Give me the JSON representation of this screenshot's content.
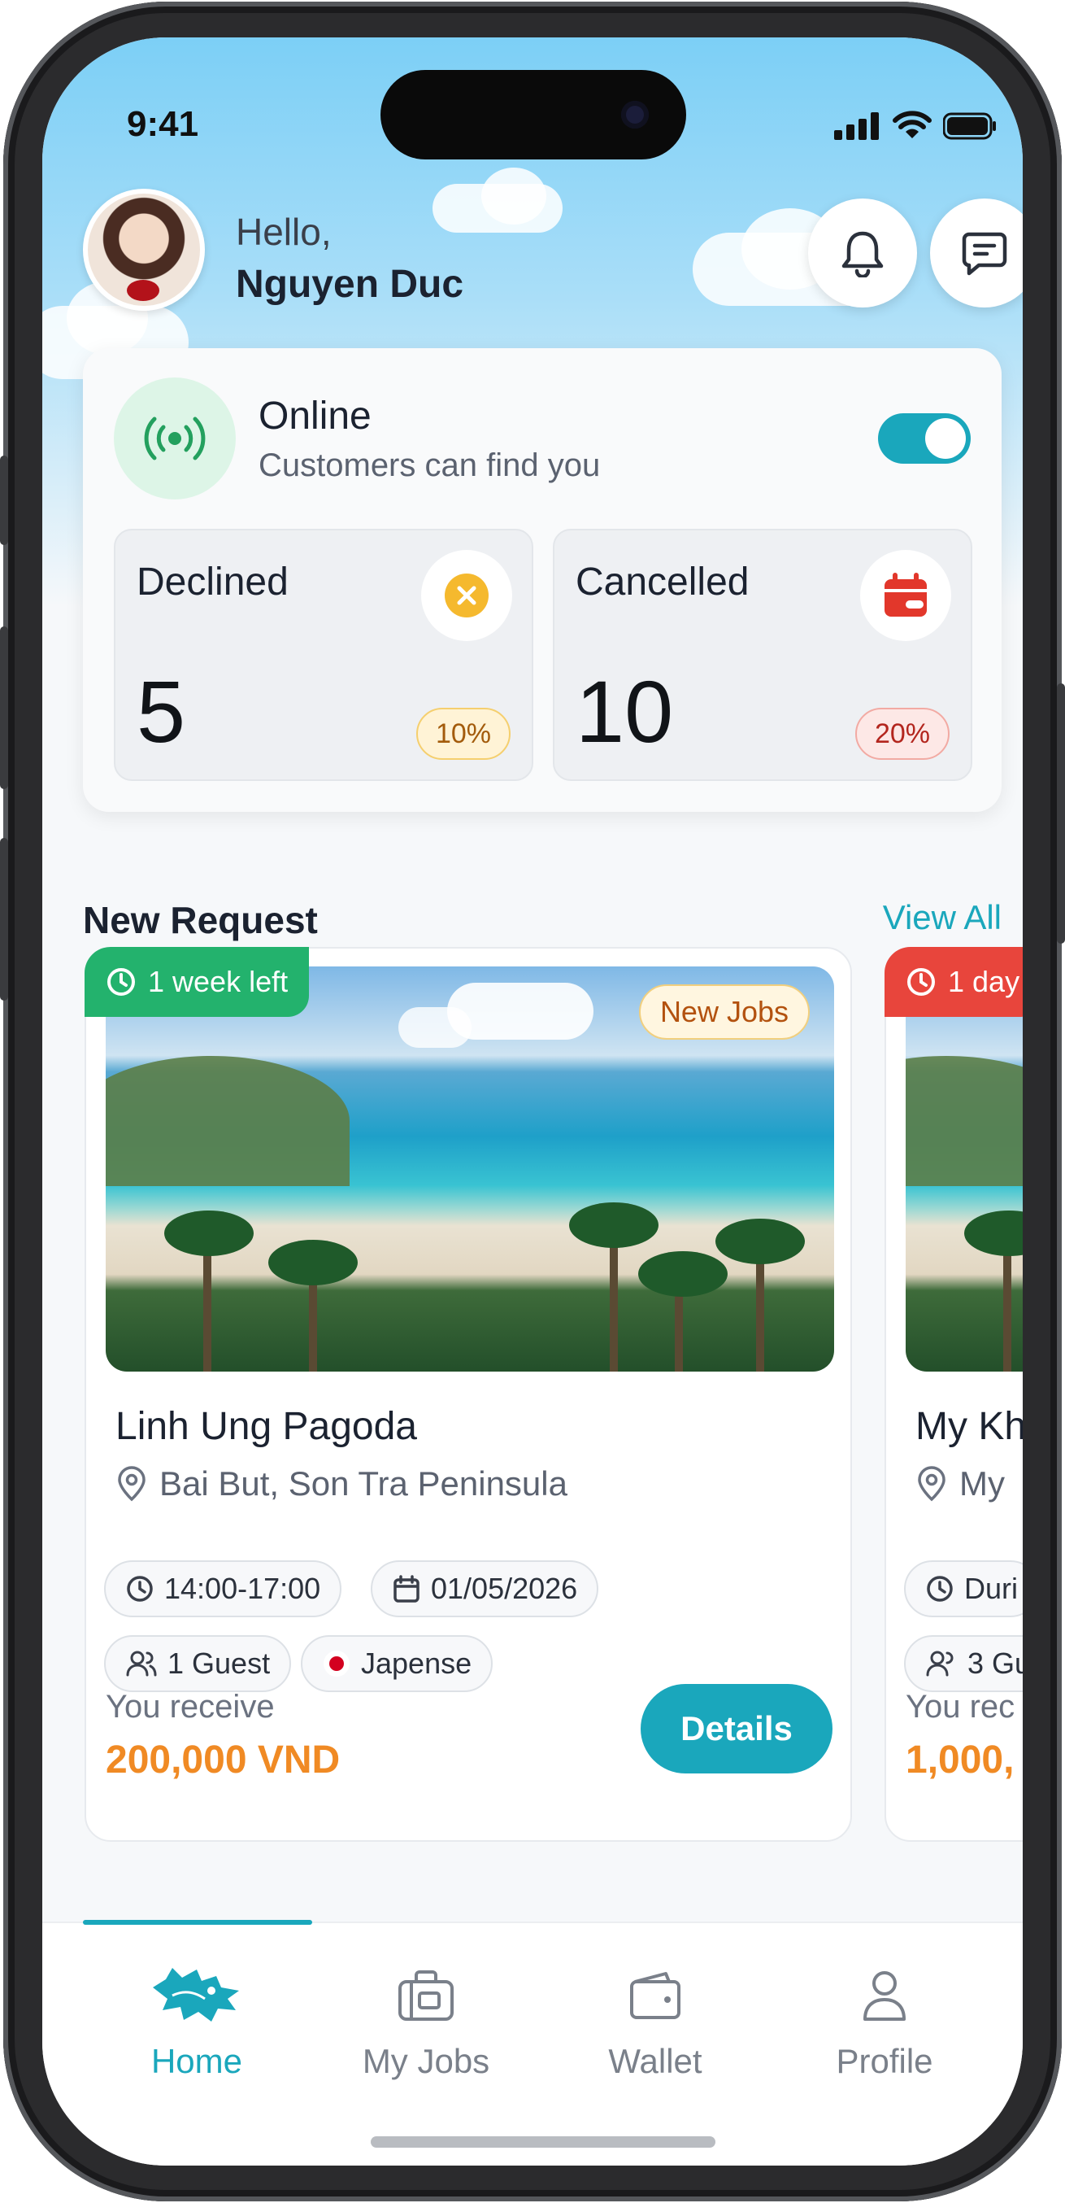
{
  "status_bar": {
    "time": "9:41"
  },
  "header": {
    "greeting": "Hello,",
    "user_name": "Nguyen Duc",
    "notification_icon": "bell-icon",
    "message_icon": "chat-icon"
  },
  "availability": {
    "title": "Online",
    "subtitle": "Customers can find you",
    "toggle_on": true,
    "icon": "broadcast-icon"
  },
  "stats": [
    {
      "label": "Declined",
      "value": "5",
      "percent": "10%",
      "icon": "x-circle-icon",
      "color": "#f5b92e"
    },
    {
      "label": "Cancelled",
      "value": "10",
      "percent": "20%",
      "icon": "calendar-cancel-icon",
      "color": "#e2372b"
    }
  ],
  "section": {
    "title": "New Request",
    "view_all": "View All"
  },
  "jobs": [
    {
      "deadline": "1 week left",
      "deadline_color": "#23b26d",
      "badge": "New Jobs",
      "title": "Linh Ung Pagoda",
      "location": "Bai But, Son Tra Peninsula",
      "time": "14:00-17:00",
      "date": "01/05/2026",
      "guests": "1 Guest",
      "language": "Japense",
      "receive_label": "You receive",
      "amount": "200,000 VND",
      "button": "Details"
    },
    {
      "deadline": "1 day",
      "deadline_color": "#e8453c",
      "title": "My Kh",
      "location": "My",
      "time": "Duri",
      "guests": "3 Gu",
      "receive_label": "You rec",
      "amount": "1,000,"
    }
  ],
  "tabs": [
    {
      "label": "Home",
      "icon": "dragon-logo-icon",
      "active": true
    },
    {
      "label": "My Jobs",
      "icon": "briefcase-icon",
      "active": false
    },
    {
      "label": "Wallet",
      "icon": "wallet-icon",
      "active": false
    },
    {
      "label": "Profile",
      "icon": "user-icon",
      "active": false
    }
  ],
  "colors": {
    "accent": "#1aa7bc",
    "amount": "#f08a24",
    "online_green": "#23b26d"
  }
}
